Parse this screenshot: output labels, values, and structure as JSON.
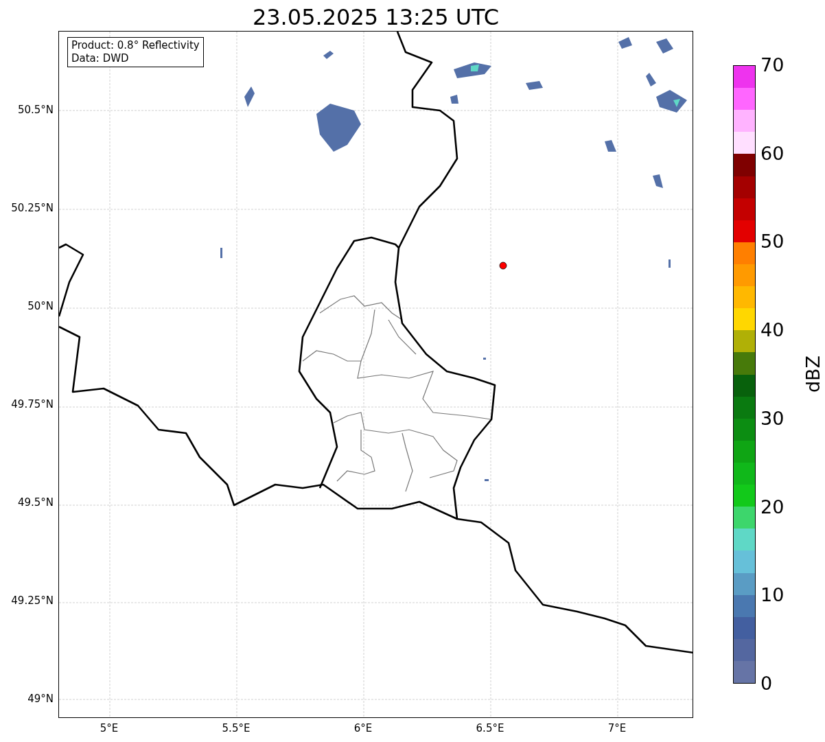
{
  "title": "23.05.2025 13:25 UTC",
  "info_box": [
    "Product: 0.8° Reflectivity",
    "Data: DWD"
  ],
  "map": {
    "yticks": [
      "50.5°N",
      "50.25°N",
      "50°N",
      "49.75°N",
      "49.5°N",
      "49.25°N",
      "49°N"
    ],
    "xticks": [
      "5°E",
      "5.5°E",
      "6°E",
      "6.5°E",
      "7°E"
    ]
  },
  "colorbar": {
    "label": "dBZ",
    "ticks": [
      "70",
      "60",
      "50",
      "40",
      "30",
      "20",
      "10",
      "0"
    ],
    "segments": [
      {
        "color": "#ee33ee"
      },
      {
        "color": "#ff66ff"
      },
      {
        "color": "#ffb3ff"
      },
      {
        "color": "#ffdfff"
      },
      {
        "color": "#7f0000"
      },
      {
        "color": "#a40000"
      },
      {
        "color": "#c40000"
      },
      {
        "color": "#e30000"
      },
      {
        "color": "#ff7f00"
      },
      {
        "color": "#ff9a00"
      },
      {
        "color": "#ffb800"
      },
      {
        "color": "#ffd700"
      },
      {
        "color": "#b0b006"
      },
      {
        "color": "#477a0a"
      },
      {
        "color": "#08610c"
      },
      {
        "color": "#0a7a10"
      },
      {
        "color": "#0c8d12"
      },
      {
        "color": "#0fa514"
      },
      {
        "color": "#10b81a"
      },
      {
        "color": "#12c91a"
      },
      {
        "color": "#3dd66c"
      },
      {
        "color": "#5fd8c6"
      },
      {
        "color": "#66c0d9"
      },
      {
        "color": "#5a9cc4"
      },
      {
        "color": "#4a78b0"
      },
      {
        "color": "#435fa0"
      },
      {
        "color": "#5467a0"
      },
      {
        "color": "#6674a6"
      }
    ]
  }
}
